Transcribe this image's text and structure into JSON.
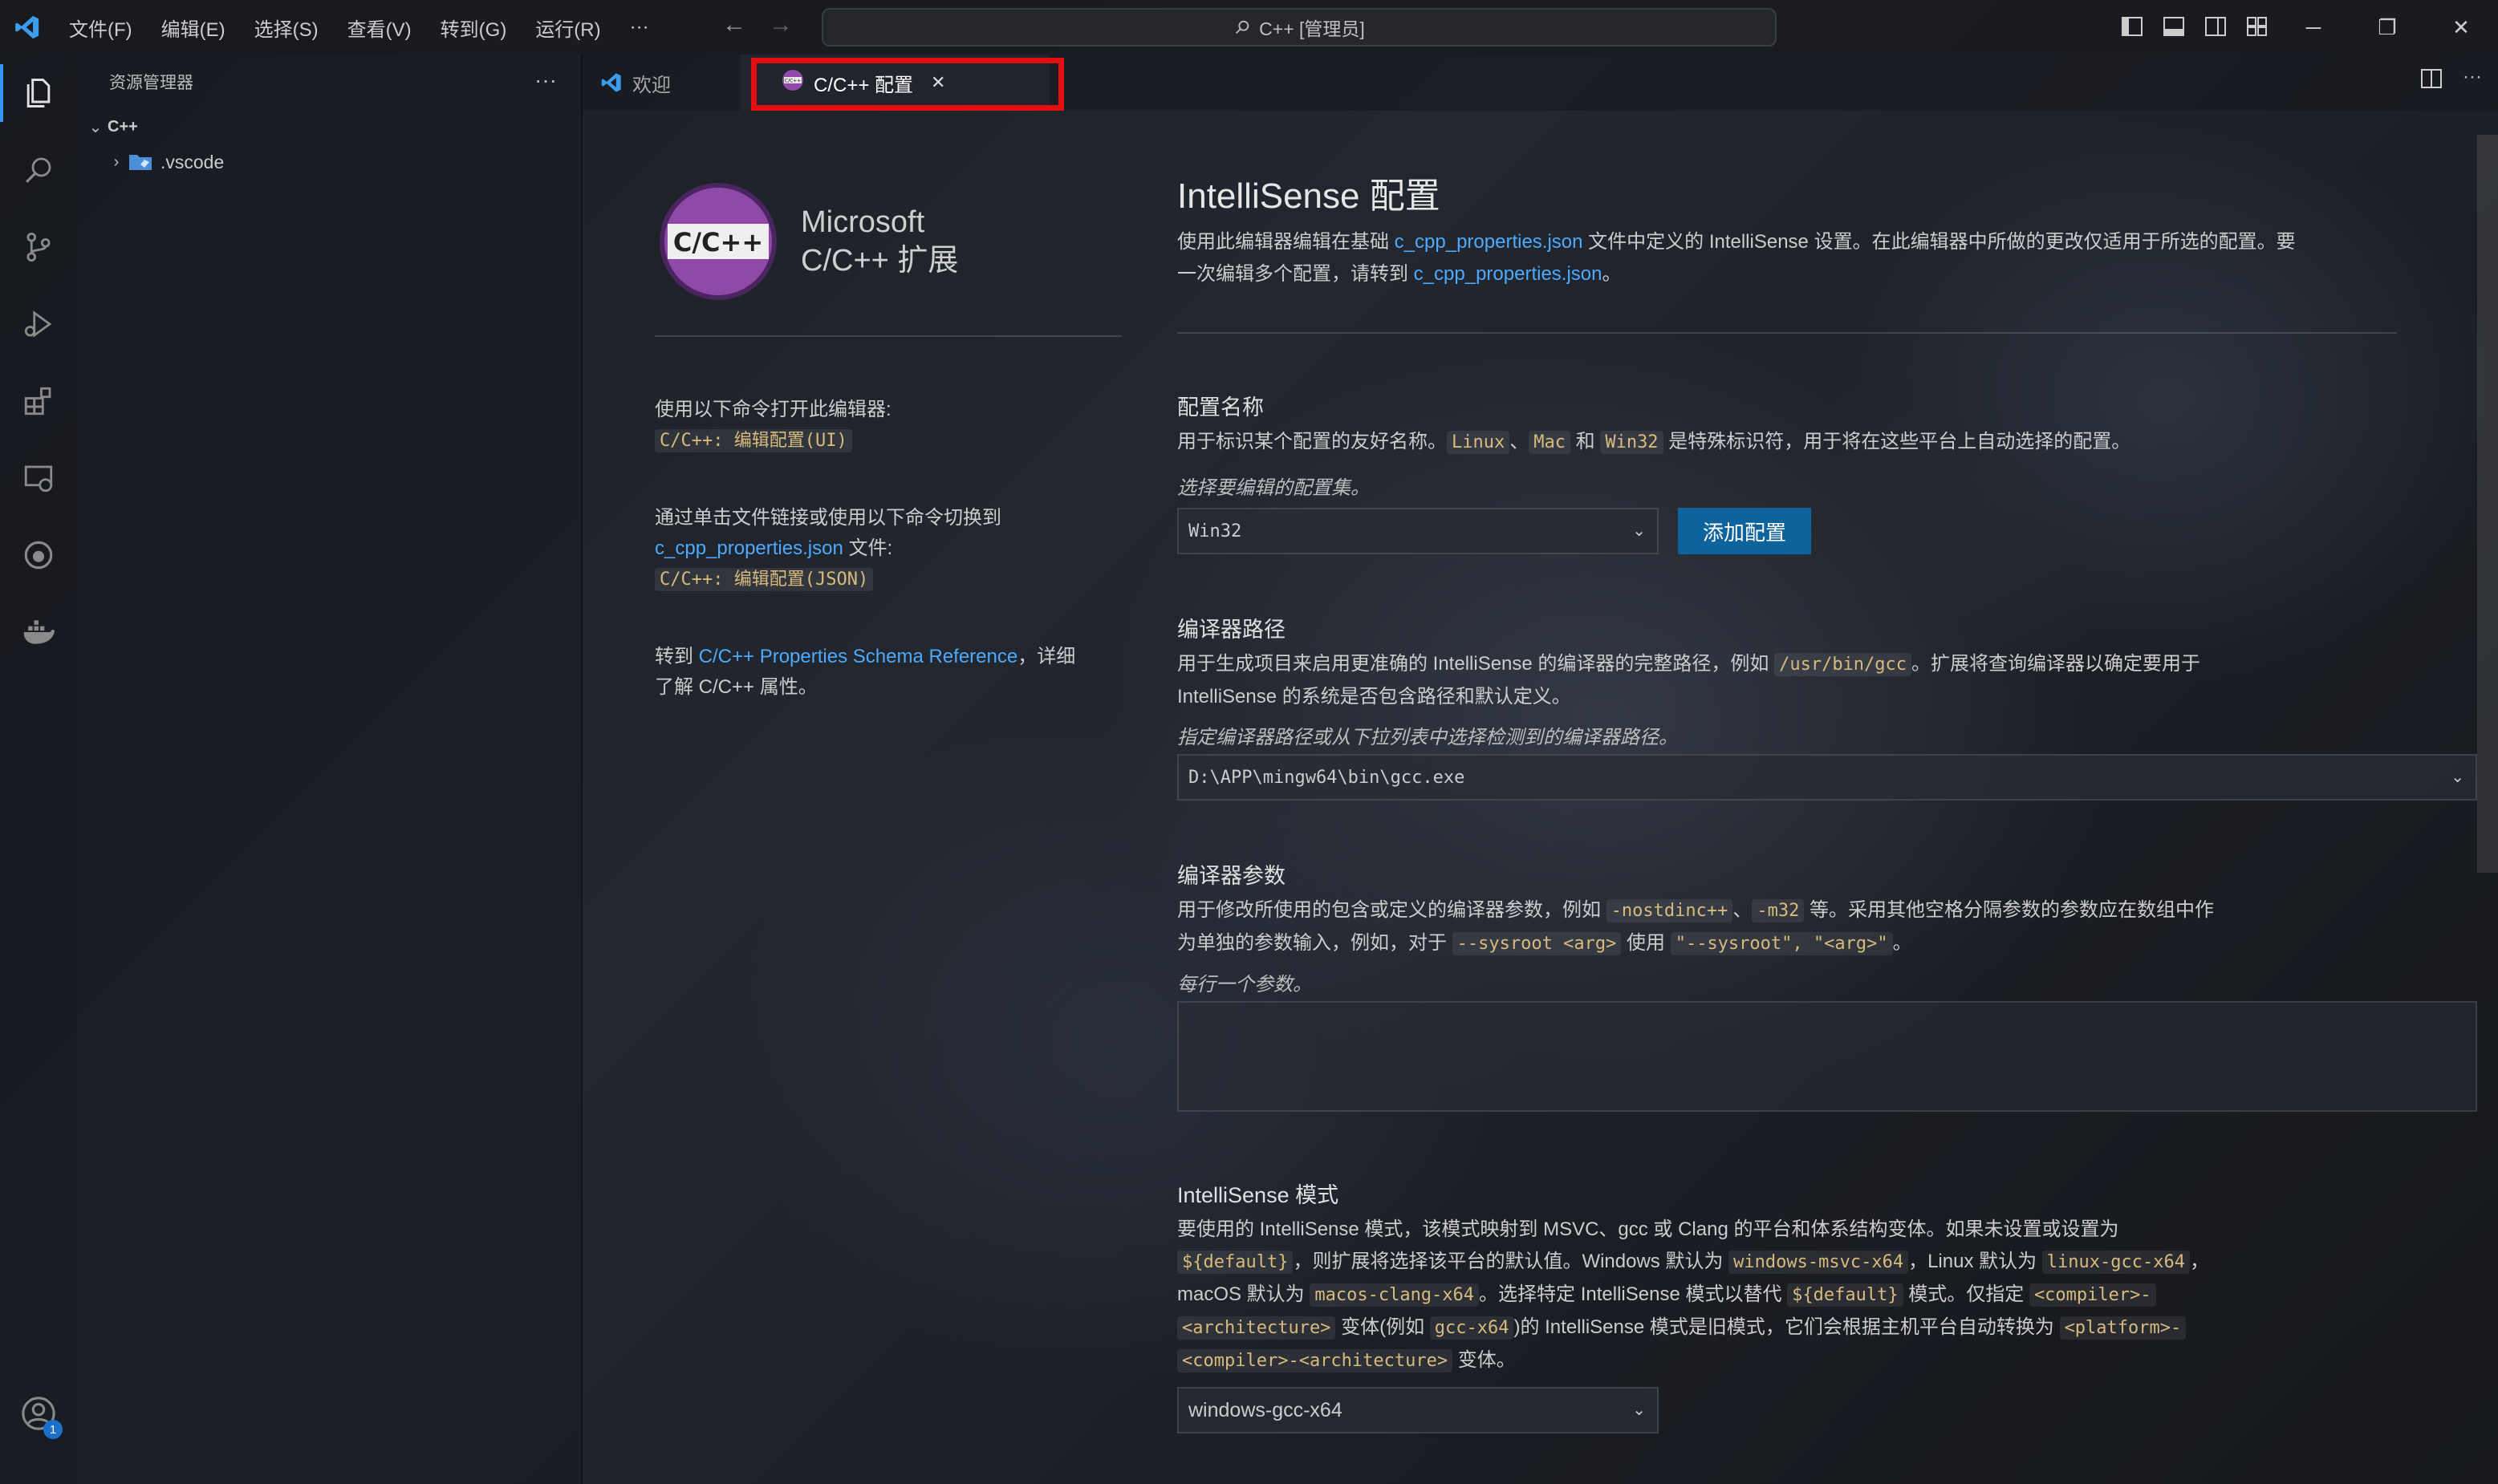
{
  "titlebar": {
    "menu": [
      "文件(F)",
      "编辑(E)",
      "选择(S)",
      "查看(V)",
      "转到(G)",
      "运行(R)",
      "···"
    ],
    "search": "C++ [管理员]"
  },
  "sidebar": {
    "title": "资源管理器",
    "more": "···",
    "root": "C++",
    "folder": ".vscode"
  },
  "tabs": {
    "welcome": "欢迎",
    "config": "C/C++ 配置",
    "close": "✕"
  },
  "accounts_badge": "1",
  "left": {
    "brand_line1": "Microsoft",
    "brand_line2": "C/C++ 扩展",
    "logo_text": "C/C++",
    "open_ui_text": "使用以下命令打开此编辑器:",
    "open_ui_cmd": "C/C++: 编辑配置(UI)",
    "switch_text_a": "通过单击文件链接或使用以下命令切换到",
    "switch_link": "c_cpp_properties.json",
    "switch_text_b": " 文件:",
    "switch_cmd": "C/C++: 编辑配置(JSON)",
    "schema_text_a": "转到 ",
    "schema_link": "C/C++ Properties Schema Reference",
    "schema_text_b": "，详细",
    "schema_text_c": "了解 C/C++ 属性。"
  },
  "main": {
    "title": "IntelliSense 配置",
    "intro_a": "使用此编辑器编辑在基础 ",
    "intro_link1": "c_cpp_properties.json",
    "intro_b": " 文件中定义的 IntelliSense 设置。在此编辑器中所做的更改仅适用于所选的配置。要",
    "intro_c": "一次编辑多个配置，请转到 ",
    "intro_link2": "c_cpp_properties.json",
    "intro_d": "。",
    "config_name": {
      "title": "配置名称",
      "desc_a": "用于标识某个配置的友好名称。",
      "code1": "Linux",
      "sep1": "、",
      "code2": "Mac",
      "and": " 和 ",
      "code3": "Win32",
      "desc_b": " 是特殊标识符，用于将在这些平台上自动选择的配置。",
      "hint": "选择要编辑的配置集。",
      "value": "Win32",
      "add_button": "添加配置"
    },
    "compiler_path": {
      "title": "编译器路径",
      "desc_a": "用于生成项目来启用更准确的 IntelliSense 的编译器的完整路径，例如 ",
      "code": "/usr/bin/gcc",
      "desc_b": "。扩展将查询编译器以确定要用于",
      "desc_c": "IntelliSense 的系统是否包含路径和默认定义。",
      "hint": "指定编译器路径或从下拉列表中选择检测到的编译器路径。",
      "value": "D:\\APP\\mingw64\\bin\\gcc.exe"
    },
    "compiler_args": {
      "title": "编译器参数",
      "desc_a": "用于修改所使用的包含或定义的编译器参数，例如 ",
      "code1": "-nostdinc++",
      "sep": "、",
      "code2": "-m32",
      "desc_b": " 等。采用其他空格分隔参数的参数应在数组中作",
      "desc_c": "为单独的参数输入，例如，对于 ",
      "code3": "--sysroot <arg>",
      "desc_d": " 使用 ",
      "code4": "\"--sysroot\", \"<arg>\"",
      "desc_e": "。",
      "hint": "每行一个参数。"
    },
    "intellisense_mode": {
      "title": "IntelliSense 模式",
      "line1": "要使用的 IntelliSense 模式，该模式映射到 MSVC、gcc 或 Clang 的平台和体系结构变体。如果未设置或设置为",
      "code_default": "${default}",
      "line2_a": "，则扩展将选择该平台的默认值。Windows 默认为 ",
      "code_win": "windows-msvc-x64",
      "line2_b": "，Linux 默认为 ",
      "code_linux": "linux-gcc-x64",
      "line2_c": "，",
      "line3_a": "macOS 默认为 ",
      "code_mac": "macos-clang-x64",
      "line3_b": "。选择特定 IntelliSense 模式以替代 ",
      "code_default2": "${default}",
      "line3_c": " 模式。仅指定 ",
      "code_ca1": "<compiler>-",
      "code_ca2": "<architecture>",
      "line4_a": " 变体(例如 ",
      "code_gcc": "gcc-x64",
      "line4_b": ")的 IntelliSense 模式是旧模式，它们会根据主机平台自动转换为 ",
      "code_plat": "<platform>-",
      "code_ca3": "<compiler>-<architecture>",
      "line5": " 变体。",
      "value": "windows-gcc-x64"
    }
  },
  "colors": {
    "accent": "#0e639c",
    "link": "#4daafc",
    "highlight_box": "#e21010",
    "code": "#d7ba7d"
  }
}
